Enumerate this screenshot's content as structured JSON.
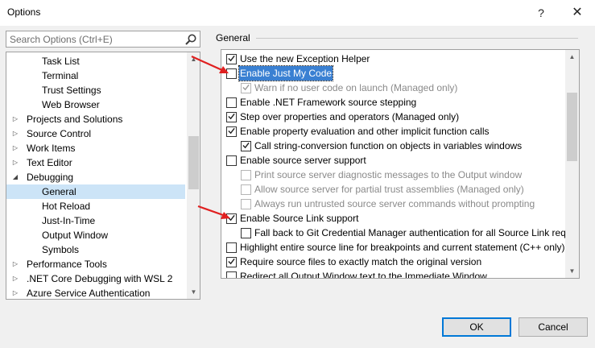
{
  "window": {
    "title": "Options",
    "help_glyph": "?",
    "close_glyph": "✕"
  },
  "search": {
    "placeholder": "Search Options (Ctrl+E)",
    "value": ""
  },
  "tree": {
    "items": [
      {
        "label": "Task List",
        "expandable": false,
        "expanded": false,
        "selected": false,
        "level": 1
      },
      {
        "label": "Terminal",
        "expandable": false,
        "expanded": false,
        "selected": false,
        "level": 1
      },
      {
        "label": "Trust Settings",
        "expandable": false,
        "expanded": false,
        "selected": false,
        "level": 1
      },
      {
        "label": "Web Browser",
        "expandable": false,
        "expanded": false,
        "selected": false,
        "level": 1
      },
      {
        "label": "Projects and Solutions",
        "expandable": true,
        "expanded": false,
        "selected": false,
        "level": 0
      },
      {
        "label": "Source Control",
        "expandable": true,
        "expanded": false,
        "selected": false,
        "level": 0
      },
      {
        "label": "Work Items",
        "expandable": true,
        "expanded": false,
        "selected": false,
        "level": 0
      },
      {
        "label": "Text Editor",
        "expandable": true,
        "expanded": false,
        "selected": false,
        "level": 0
      },
      {
        "label": "Debugging",
        "expandable": true,
        "expanded": true,
        "selected": false,
        "level": 0
      },
      {
        "label": "General",
        "expandable": false,
        "expanded": false,
        "selected": true,
        "level": 1
      },
      {
        "label": "Hot Reload",
        "expandable": false,
        "expanded": false,
        "selected": false,
        "level": 1
      },
      {
        "label": "Just-In-Time",
        "expandable": false,
        "expanded": false,
        "selected": false,
        "level": 1
      },
      {
        "label": "Output Window",
        "expandable": false,
        "expanded": false,
        "selected": false,
        "level": 1
      },
      {
        "label": "Symbols",
        "expandable": false,
        "expanded": false,
        "selected": false,
        "level": 1
      },
      {
        "label": "Performance Tools",
        "expandable": true,
        "expanded": false,
        "selected": false,
        "level": 0
      },
      {
        "label": ".NET Core Debugging with WSL 2",
        "expandable": true,
        "expanded": false,
        "selected": false,
        "level": 0
      },
      {
        "label": "Azure Service Authentication",
        "expandable": true,
        "expanded": false,
        "selected": false,
        "level": 0
      }
    ]
  },
  "section": {
    "title": "General"
  },
  "options": [
    {
      "label": "Use the new Exception Helper",
      "checked": true,
      "disabled": false,
      "indent": 0,
      "focused": false
    },
    {
      "label": "Enable Just My Code",
      "checked": false,
      "disabled": false,
      "indent": 0,
      "focused": true
    },
    {
      "label": "Warn if no user code on launch (Managed only)",
      "checked": true,
      "disabled": true,
      "indent": 1,
      "focused": false
    },
    {
      "label": "Enable .NET Framework source stepping",
      "checked": false,
      "disabled": false,
      "indent": 0,
      "focused": false
    },
    {
      "label": "Step over properties and operators (Managed only)",
      "checked": true,
      "disabled": false,
      "indent": 0,
      "focused": false
    },
    {
      "label": "Enable property evaluation and other implicit function calls",
      "checked": true,
      "disabled": false,
      "indent": 0,
      "focused": false
    },
    {
      "label": "Call string-conversion function on objects in variables windows",
      "checked": true,
      "disabled": false,
      "indent": 1,
      "focused": false
    },
    {
      "label": "Enable source server support",
      "checked": false,
      "disabled": false,
      "indent": 0,
      "focused": false
    },
    {
      "label": "Print source server diagnostic messages to the Output window",
      "checked": false,
      "disabled": true,
      "indent": 1,
      "focused": false
    },
    {
      "label": "Allow source server for partial trust assemblies (Managed only)",
      "checked": false,
      "disabled": true,
      "indent": 1,
      "focused": false
    },
    {
      "label": "Always run untrusted source server commands without prompting",
      "checked": false,
      "disabled": true,
      "indent": 1,
      "focused": false
    },
    {
      "label": "Enable Source Link support",
      "checked": true,
      "disabled": false,
      "indent": 0,
      "focused": false
    },
    {
      "label": "Fall back to Git Credential Manager authentication for all Source Link requ",
      "checked": false,
      "disabled": false,
      "indent": 1,
      "focused": false
    },
    {
      "label": "Highlight entire source line for breakpoints and current statement (C++ only)",
      "checked": false,
      "disabled": false,
      "indent": 0,
      "focused": false
    },
    {
      "label": "Require source files to exactly match the original version",
      "checked": true,
      "disabled": false,
      "indent": 0,
      "focused": false
    },
    {
      "label": "Redirect all Output Window text to the Immediate Window",
      "checked": false,
      "disabled": false,
      "indent": 0,
      "focused": false
    }
  ],
  "buttons": {
    "ok": "OK",
    "cancel": "Cancel"
  },
  "colors": {
    "annotation_arrow": "#e02020",
    "selection": "#cce4f7",
    "focus_highlight": "#3a80d2",
    "ok_border": "#0078d7"
  },
  "icons": {
    "search": "magnifier-icon",
    "tree_collapsed": "triangle-right-icon",
    "tree_expanded": "triangle-down-icon",
    "check": "checkmark-icon"
  }
}
